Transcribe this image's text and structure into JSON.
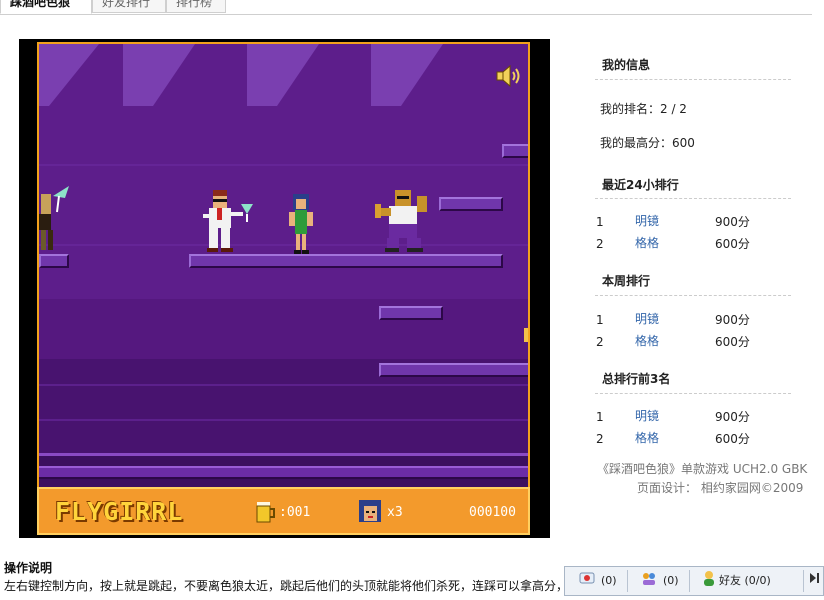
{
  "tabs": [
    "踩酒吧色狼",
    "好友排行",
    "排行榜"
  ],
  "game": {
    "logo": "FLYGIRRL",
    "beer_count": ":001",
    "lives": "x3",
    "score": "000100"
  },
  "sidebar": {
    "my_info_title": "我的信息",
    "my_rank": "我的排名：2 / 2",
    "my_best": "我的最高分：600",
    "sections": [
      {
        "title": "最近24小排行",
        "rows": [
          {
            "idx": "1",
            "name": "明镜",
            "score": "900分"
          },
          {
            "idx": "2",
            "name": "格格",
            "score": "600分"
          }
        ]
      },
      {
        "title": "本周排行",
        "rows": [
          {
            "idx": "1",
            "name": "明镜",
            "score": "900分"
          },
          {
            "idx": "2",
            "name": "格格",
            "score": "600分"
          }
        ]
      },
      {
        "title": "总排行前3名",
        "rows": [
          {
            "idx": "1",
            "name": "明镜",
            "score": "900分"
          },
          {
            "idx": "2",
            "name": "格格",
            "score": "600分"
          }
        ]
      }
    ],
    "footer_line1": "《踩酒吧色狼》单款游戏  UCH2.0 GBK",
    "footer_line2": "页面设计：  相约家园网©2009"
  },
  "instructions": {
    "title": "操作说明",
    "text": "左右键控制方向，按上就是跳起，不要离色狼太近，跳起后他们的头顶就能将他们杀死，连踩可以拿高分，"
  },
  "dock": {
    "messages": "(0)",
    "notices": "(0)",
    "friends": "好友 (0/0)"
  }
}
